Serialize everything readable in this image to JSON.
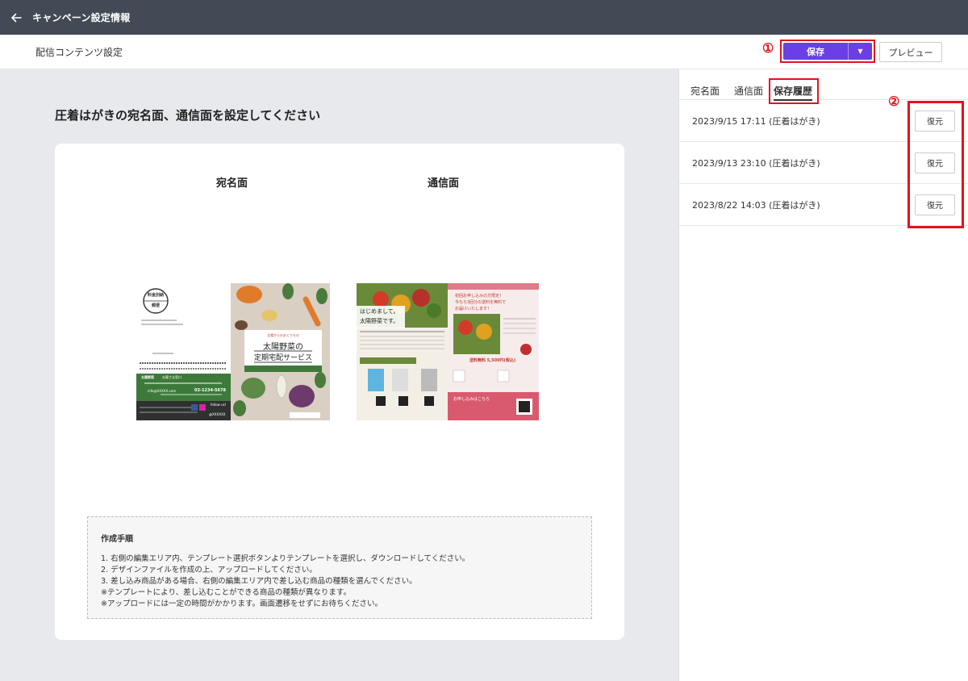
{
  "header": {
    "title": "キャンペーン設定情報"
  },
  "subheader": {
    "title": "配信コンテンツ設定",
    "save_label": "保存",
    "preview_label": "プレビュー",
    "annotation_1": "①"
  },
  "main": {
    "heading": "圧着はがきの宛名面、通信面を設定してください",
    "columns": [
      "宛名面",
      "通信面"
    ],
    "address_card": {
      "stamp_line1": "料金別納",
      "stamp_line2": "郵便",
      "company": "太陽野菜",
      "company_suffix": "お客さま窓口",
      "email": "info@XXXXX.com",
      "phone": "03-1234-5678",
      "follow": "follow us!",
      "sns_id": "@XXXXXX",
      "headline_small": "太陽からのおくりもの",
      "headline_line1": "太陽野菜の",
      "headline_line2": "定期宅配サービス"
    },
    "comm_card": {
      "hero_line1": "はじめまして。",
      "hero_line2": "太陽野菜です。",
      "campaign_text1": "初回お申し込みの方限定！",
      "campaign_text2": "今なら3回分の送料を無料で",
      "campaign_text3": "お届けいたします！",
      "price": "送料無料 5,500円(税込)",
      "cta": "お申し込みはこちら"
    },
    "guide": {
      "title": "作成手順",
      "lines": [
        "1. 右側の編集エリア内、テンプレート選択ボタンよりテンプレートを選択し、ダウンロードしてください。",
        "2. デザインファイルを作成の上、アップロードしてください。",
        "3. 差し込み商品がある場合、右側の編集エリア内で差し込む商品の種類を選んでください。",
        "※テンプレートにより、差し込むことができる商品の種類が異なります。",
        "※アップロードには一定の時間がかかります。画面遷移をせずにお待ちください。"
      ]
    }
  },
  "panel": {
    "tabs": [
      "宛名面",
      "通信面",
      "保存履歴"
    ],
    "active_tab": "保存履歴",
    "annotation_2": "②",
    "history": [
      {
        "label": "2023/9/15 17:11 (圧着はがき)",
        "restore": "復元"
      },
      {
        "label": "2023/9/13 23:10 (圧着はがき)",
        "restore": "復元"
      },
      {
        "label": "2023/8/22 14:03 (圧着はがき)",
        "restore": "復元"
      }
    ]
  },
  "colors": {
    "topbar": "#434a56",
    "accent": "#6b3ee6",
    "annotation": "#e0141e",
    "green": "#3d7a3a"
  }
}
